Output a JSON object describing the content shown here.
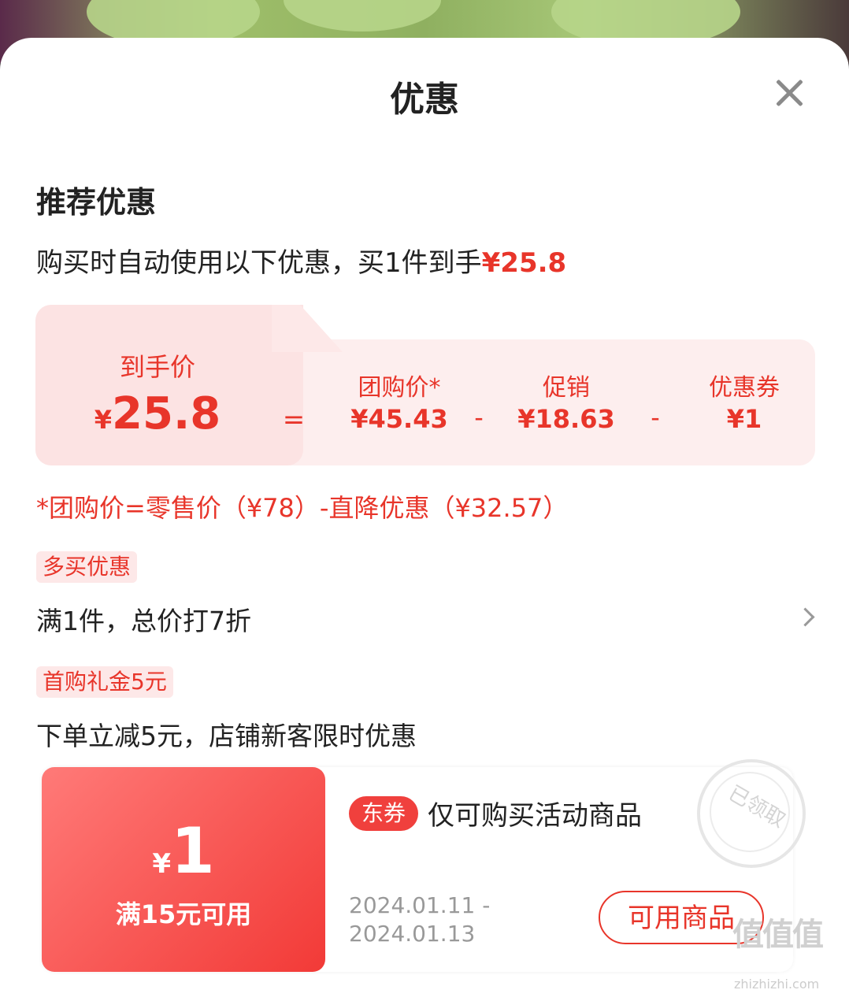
{
  "sheet": {
    "title": "优惠"
  },
  "recommend": {
    "section_title": "推荐优惠",
    "desc_prefix": "购买时自动使用以下优惠，买1件到手",
    "desc_price": "¥25.8"
  },
  "calc": {
    "final_label": "到手价",
    "final_yen": "¥",
    "final_value": "25.8",
    "equals": "=",
    "items": [
      {
        "label": "团购价*",
        "value": "¥45.43"
      },
      {
        "label": "促销",
        "value": "¥18.63"
      },
      {
        "label": "优惠券",
        "value": "¥1"
      }
    ],
    "minus": "-"
  },
  "note": "*团购价=零售价（¥78）-直降优惠（¥32.57）",
  "promos": [
    {
      "tag": "多买优惠",
      "text": "满1件，总价打7折"
    },
    {
      "tag": "首购礼金5元",
      "text": "下单立减5元，店铺新客限时优惠"
    }
  ],
  "coupon": {
    "yen": "¥",
    "amount": "1",
    "condition": "满15元可用",
    "badge": "东券",
    "name": "仅可购买活动商品",
    "date_start": "2024.01.11 -",
    "date_end": "2024.01.13",
    "button": "可用商品",
    "stamp": "已领取"
  },
  "watermark": {
    "logo": "值值值",
    "url": "zhizhizhi.com"
  },
  "colors": {
    "accent": "#e8352a",
    "panel": "#fdeeee"
  }
}
